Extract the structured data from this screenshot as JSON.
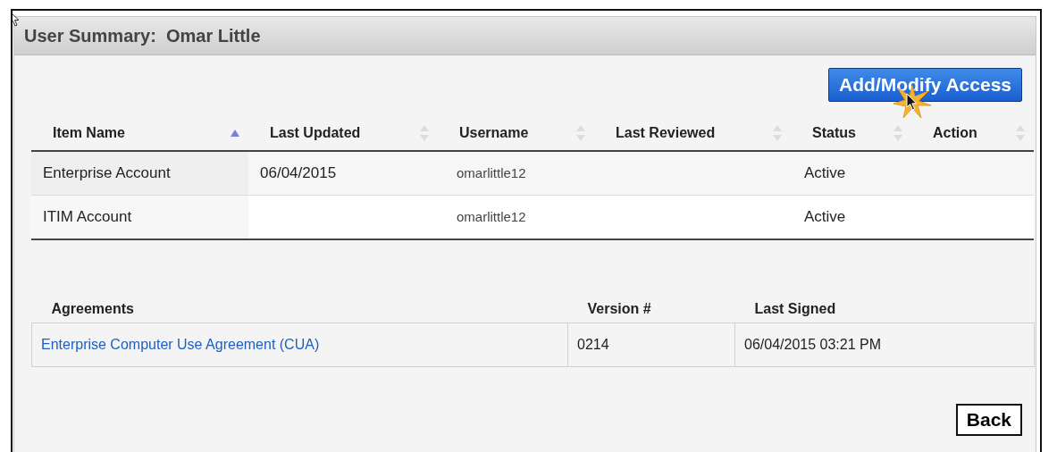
{
  "panel": {
    "title": "User Summary:  Omar Little"
  },
  "add_button": {
    "label": "Add/Modify Access"
  },
  "accounts": {
    "columns": [
      {
        "label": "Item Name",
        "sorted_ascending": true
      },
      {
        "label": "Last Updated",
        "sorted_ascending": false
      },
      {
        "label": "Username",
        "sorted_ascending": false
      },
      {
        "label": "Last Reviewed",
        "sorted_ascending": false
      },
      {
        "label": "Status",
        "sorted_ascending": false
      },
      {
        "label": "Action",
        "sorted_ascending": false
      }
    ],
    "rows": [
      {
        "item_name": "Enterprise Account",
        "last_updated": "06/04/2015",
        "username": "omarlittle12",
        "status": "Active"
      },
      {
        "item_name": "ITIM Account",
        "username": "omarlittle12",
        "status": "Active"
      }
    ]
  },
  "agreements": {
    "columns": [
      "Agreements",
      "Version #",
      "Last Signed"
    ],
    "rows": [
      {
        "name": "Enterprise Computer Use Agreement (CUA)",
        "version": "0214",
        "last_signed": "06/04/2015 03:21 PM"
      }
    ]
  },
  "back_button": {
    "label": "Back"
  }
}
